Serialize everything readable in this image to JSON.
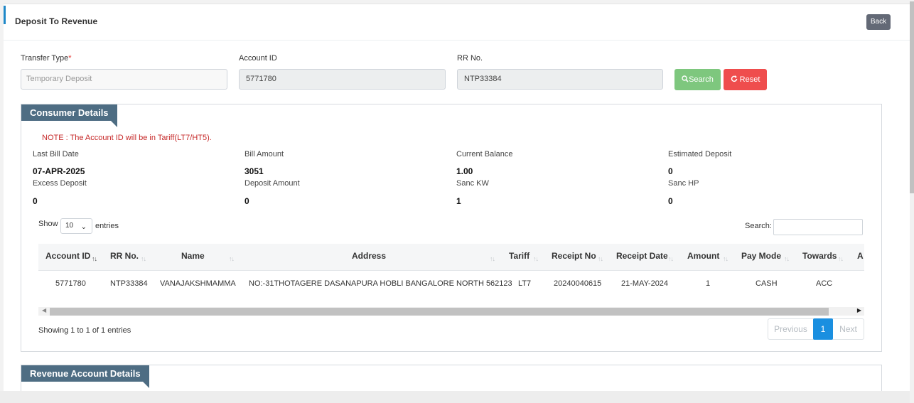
{
  "header": {
    "title": "Deposit To Revenue",
    "back_label": "Back"
  },
  "form": {
    "transfer_type_label": "Transfer Type",
    "required_mark": "*",
    "transfer_type_value": "Temporary Deposit",
    "account_id_label": "Account ID",
    "account_id_value": "5771780",
    "rr_label": "RR No.",
    "rr_value": "NTP33384",
    "search_label": "Search",
    "reset_label": "Reset"
  },
  "consumer": {
    "title": "Consumer Details",
    "note": "NOTE : The Account ID will be in Tariff(LT7/HT5).",
    "fields": [
      {
        "label": "Last Bill Date",
        "value": "07-APR-2025"
      },
      {
        "label": "Bill Amount",
        "value": "3051"
      },
      {
        "label": "Current Balance",
        "value": "1.00"
      },
      {
        "label": "Estimated Deposit",
        "value": "0"
      },
      {
        "label": "Excess Deposit",
        "value": "0"
      },
      {
        "label": "Deposit Amount",
        "value": "0"
      },
      {
        "label": "Sanc KW",
        "value": "1"
      },
      {
        "label": "Sanc HP",
        "value": "0"
      }
    ],
    "table": {
      "show_label": "Show",
      "page_size": "10",
      "entries_label": "entries",
      "search_label": "Search:",
      "columns": [
        "Account ID",
        "RR No.",
        "Name",
        "Address",
        "Tariff",
        "Receipt No",
        "Receipt Date",
        "Amount",
        "Pay Mode",
        "Towards",
        "A"
      ],
      "rows": [
        [
          "5771780",
          "NTP33384",
          "VANAJAKSHMAMMA",
          "NO:-31THOTAGERE DASANAPURA HOBLI BANGALORE NORTH 562123",
          "LT7",
          "20240040615",
          "21-MAY-2024",
          "1",
          "CASH",
          "ACC",
          ""
        ]
      ],
      "info": "Showing 1 to 1 of 1 entries",
      "pager": {
        "previous": "Previous",
        "current": "1",
        "next": "Next"
      }
    }
  },
  "revenue": {
    "title": "Revenue Account Details"
  }
}
